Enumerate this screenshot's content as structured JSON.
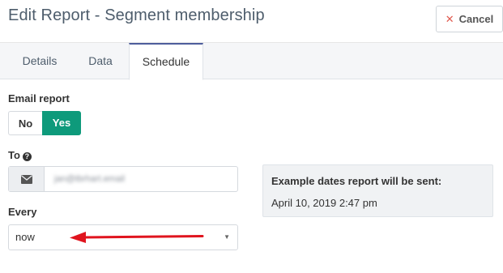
{
  "header": {
    "title": "Edit Report - Segment membership",
    "cancel_label": "Cancel"
  },
  "tabs": [
    {
      "label": "Details",
      "active": false
    },
    {
      "label": "Data",
      "active": false
    },
    {
      "label": "Schedule",
      "active": true
    }
  ],
  "email_report": {
    "label": "Email report",
    "options": [
      "No",
      "Yes"
    ],
    "selected": "Yes"
  },
  "to": {
    "label": "To",
    "value": "jan@tbrhart.email",
    "icon": "envelope-icon",
    "help_icon": "question-circle-icon"
  },
  "every": {
    "label": "Every",
    "selected": "now"
  },
  "example_dates": {
    "title": "Example dates report will be sent:",
    "dates": [
      "April 10, 2019 2:47 pm"
    ]
  },
  "colors": {
    "accent_toggle": "#0e9a7b",
    "tab_active_border": "#4e5d9c",
    "annotation_arrow": "#e0141e",
    "cancel_icon": "#e05a4f"
  }
}
